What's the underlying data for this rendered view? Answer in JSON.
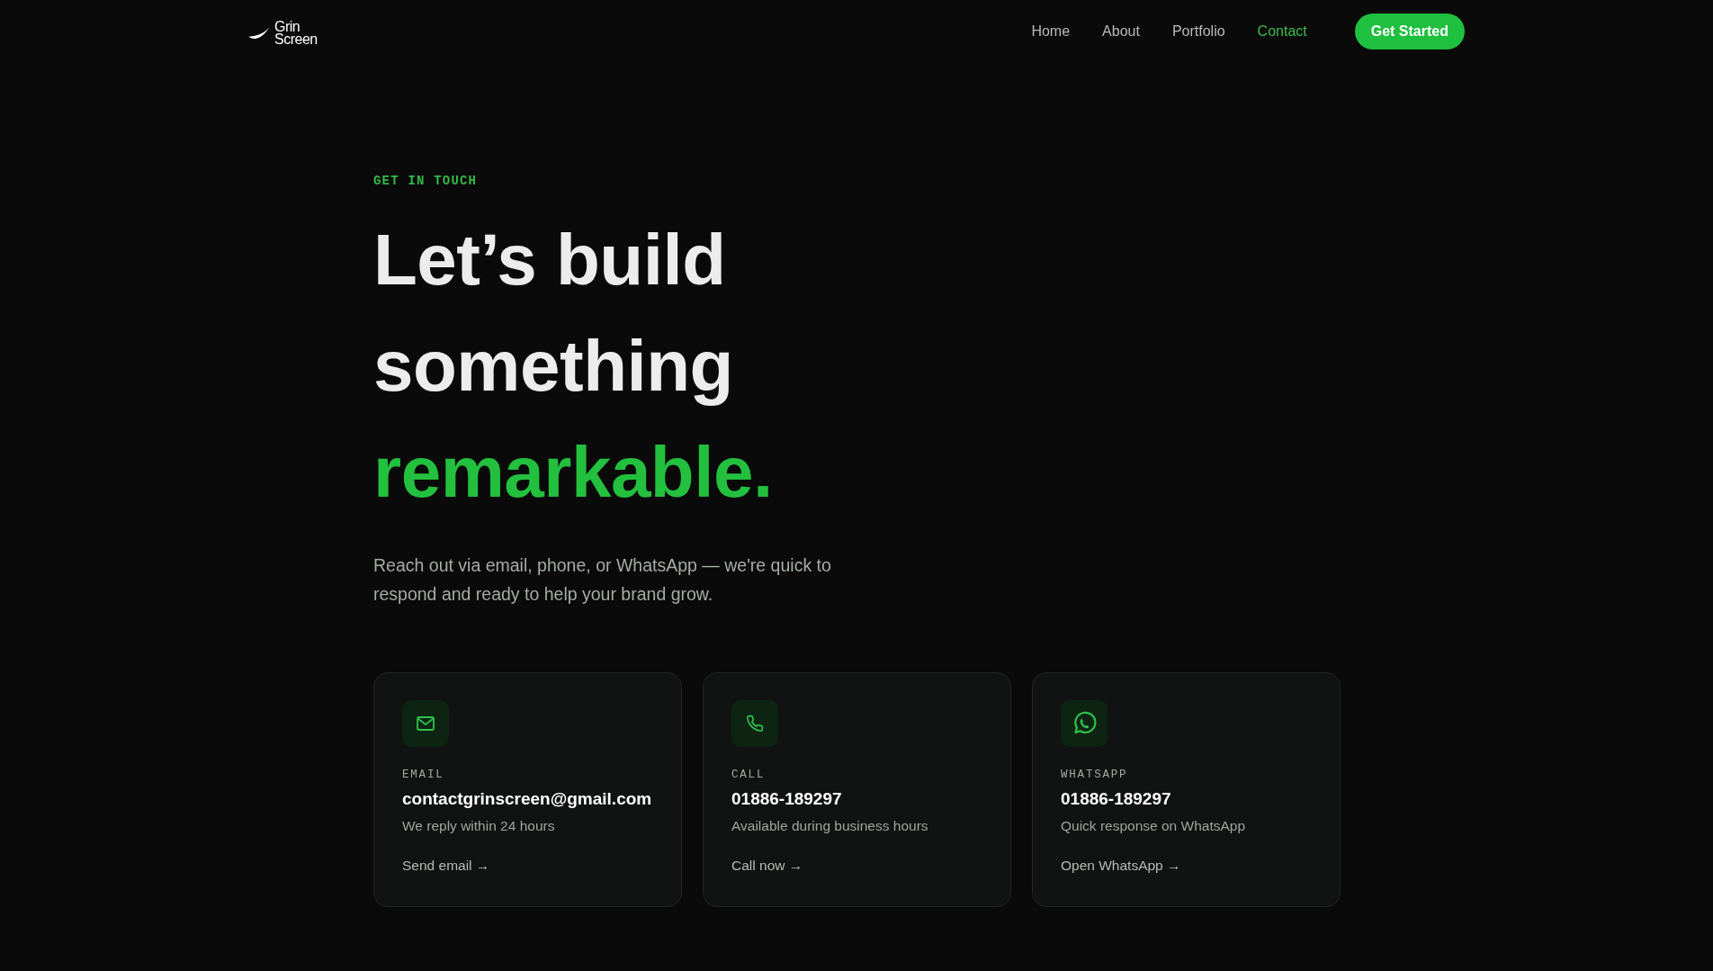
{
  "header": {
    "logo": {
      "lines": [
        "Grin",
        "Screen"
      ]
    },
    "nav": [
      {
        "label": "Home",
        "selected": false
      },
      {
        "label": "About",
        "selected": false
      },
      {
        "label": "Portfolio",
        "selected": false
      },
      {
        "label": "Contact",
        "selected": true
      }
    ],
    "cta": "Get Started"
  },
  "hero": {
    "eyebrow": "GET IN TOUCH",
    "heading": [
      {
        "text": "Let’s build",
        "accent": false
      },
      {
        "text": "something",
        "accent": false
      },
      {
        "text": "remarkable.",
        "accent": true
      }
    ],
    "intro": "Reach out via email, phone, or WhatsApp — we're quick to respond and ready to help your brand grow."
  },
  "contact_cards": [
    {
      "kind": "email",
      "label": "EMAIL",
      "value": "contactgrinscreen@gmail.com",
      "note": "We reply within 24 hours",
      "link": "Send email →"
    },
    {
      "kind": "phone",
      "label": "CALL",
      "value": "01886-189297",
      "note": "Available during business hours",
      "link": "Call now →"
    },
    {
      "kind": "whatsapp",
      "label": "WHATSAPP",
      "value": "01886-189297",
      "note": "Quick response on WhatsApp",
      "link": "Open WhatsApp →"
    }
  ]
}
